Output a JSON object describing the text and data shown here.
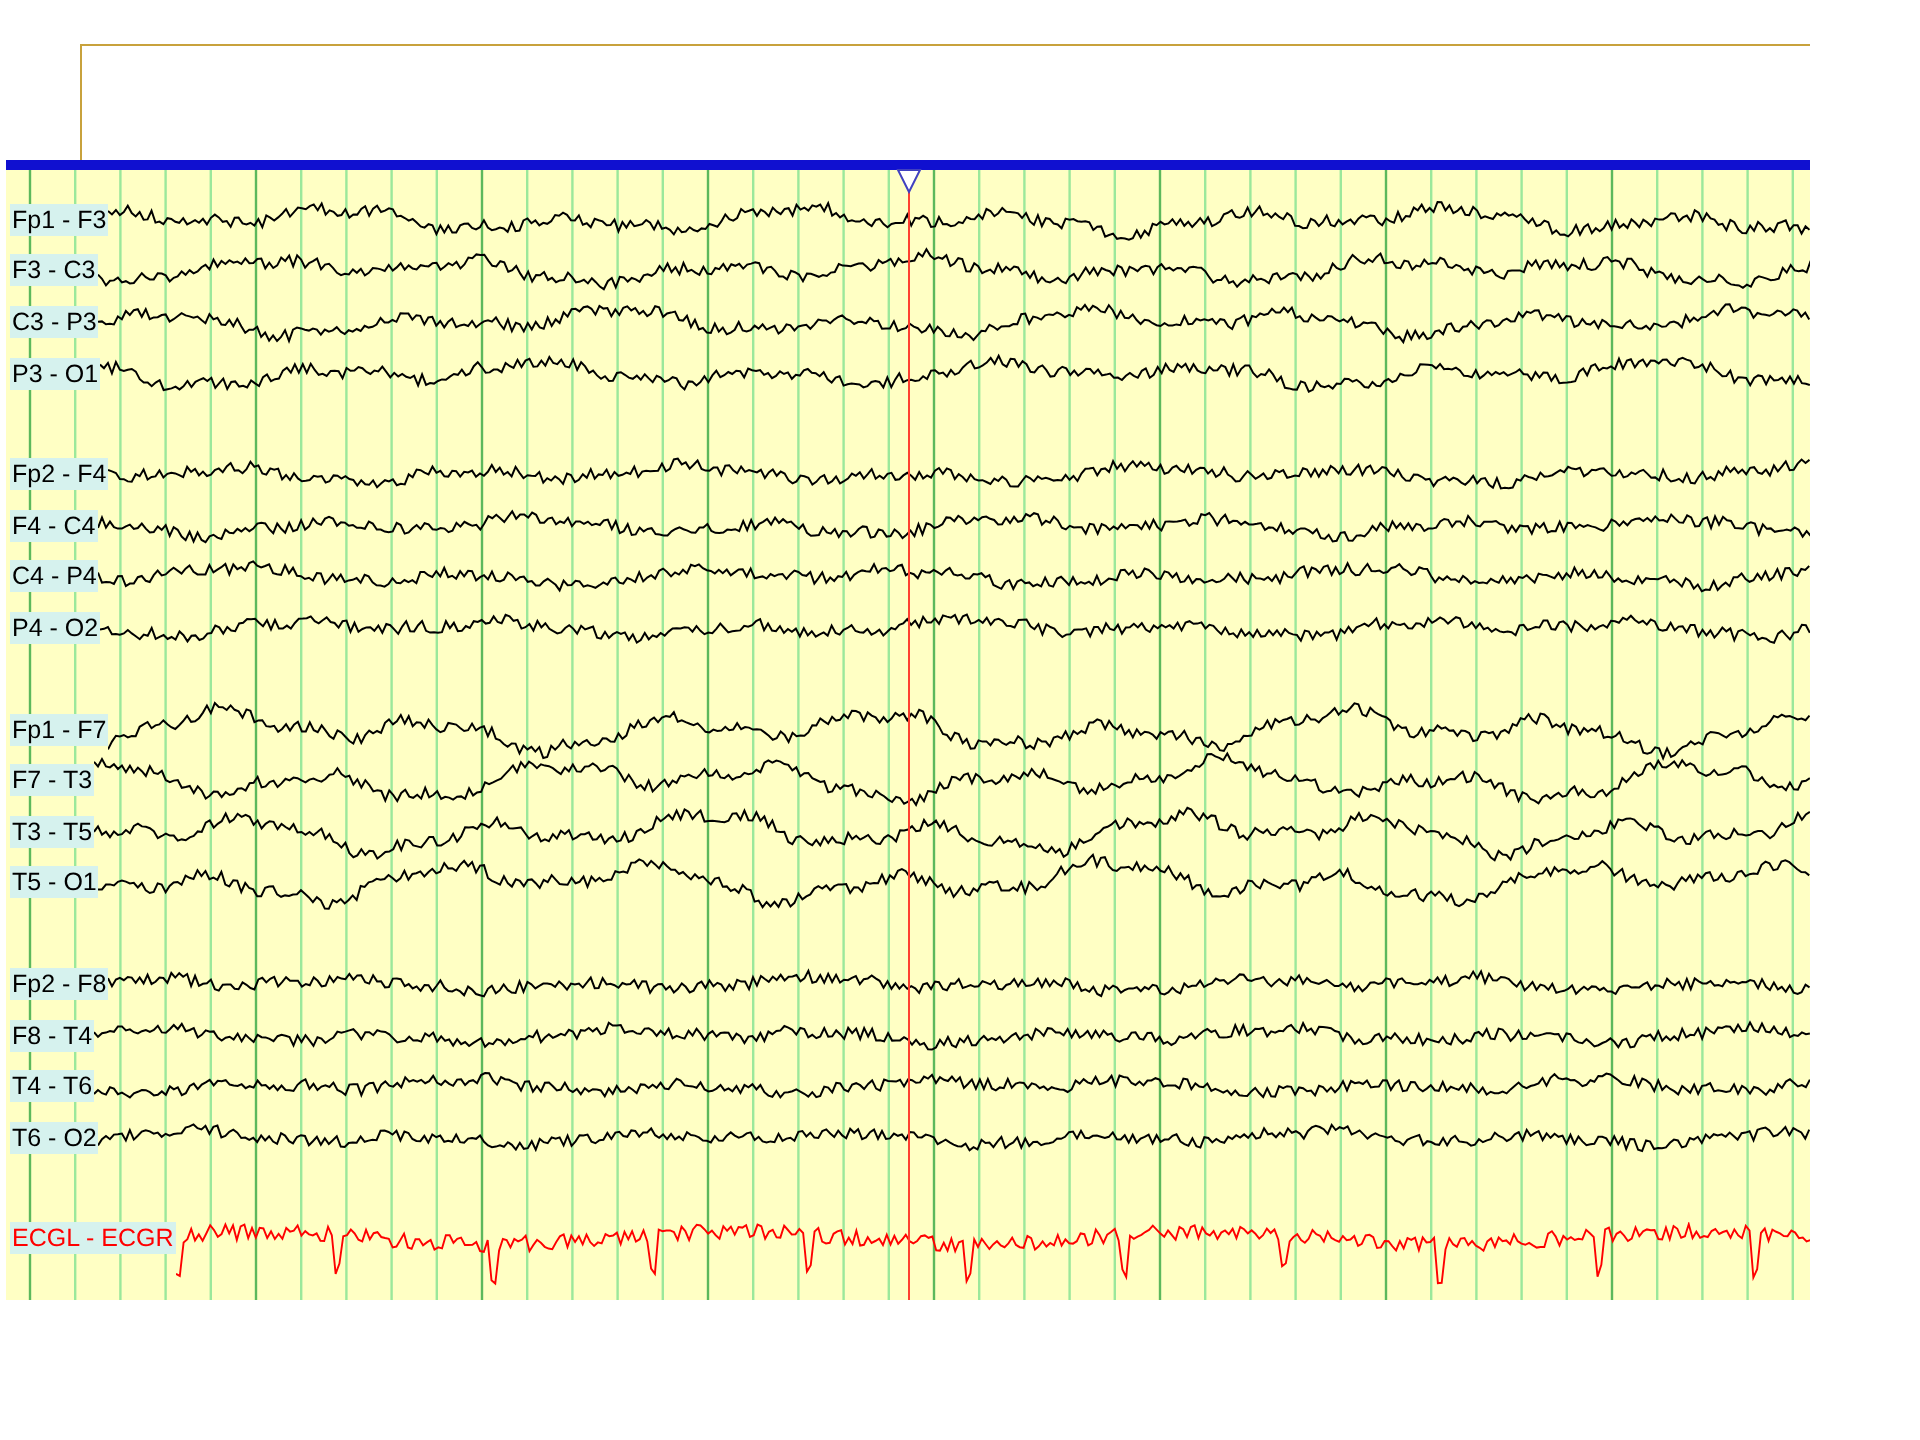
{
  "channel_groups": [
    {
      "channels": [
        {
          "label": "Fp1 - F3",
          "kind": "eeg",
          "color": "#000000"
        },
        {
          "label": "F3 - C3",
          "kind": "eeg",
          "color": "#000000"
        },
        {
          "label": "C3 - P3",
          "kind": "eeg",
          "color": "#000000"
        },
        {
          "label": "P3 - O1",
          "kind": "eeg",
          "color": "#000000"
        }
      ]
    },
    {
      "channels": [
        {
          "label": "Fp2 - F4",
          "kind": "eeg",
          "color": "#000000"
        },
        {
          "label": "F4 - C4",
          "kind": "eeg",
          "color": "#000000"
        },
        {
          "label": "C4 - P4",
          "kind": "eeg",
          "color": "#000000"
        },
        {
          "label": "P4 - O2",
          "kind": "eeg",
          "color": "#000000"
        }
      ]
    },
    {
      "channels": [
        {
          "label": "Fp1 - F7",
          "kind": "eeg",
          "color": "#000000"
        },
        {
          "label": "F7 - T3",
          "kind": "eeg",
          "color": "#000000"
        },
        {
          "label": "T3 - T5",
          "kind": "eeg",
          "color": "#000000"
        },
        {
          "label": "T5 - O1",
          "kind": "eeg",
          "color": "#000000"
        }
      ]
    },
    {
      "channels": [
        {
          "label": "Fp2 - F8",
          "kind": "eeg",
          "color": "#000000"
        },
        {
          "label": "F8 - T4",
          "kind": "eeg",
          "color": "#000000"
        },
        {
          "label": "T4 - T6",
          "kind": "eeg",
          "color": "#000000"
        },
        {
          "label": "T6 - O2",
          "kind": "eeg",
          "color": "#000000"
        }
      ]
    },
    {
      "channels": [
        {
          "label": "ECGL - ECGR",
          "kind": "ecg",
          "color": "#ff0000"
        }
      ]
    }
  ]
}
